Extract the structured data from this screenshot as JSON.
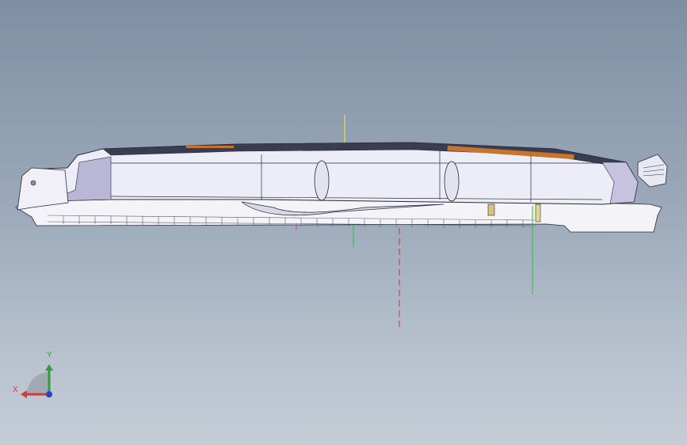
{
  "viewport": {
    "background_top": "#7f8fa3",
    "background_bottom": "#c4ccd6"
  },
  "model": {
    "body_fill": "#ecedf6",
    "body_shade": "#b9b6d6",
    "edge_color": "#2a2a3a",
    "accent_orange": "#c8742a",
    "axis_yellow": "#e6e635",
    "axis_green": "#35c24a",
    "axis_red": "#d23a3a"
  },
  "triad": {
    "x_label": "X",
    "y_label": "Y",
    "x_color": "#d23a3a",
    "y_color": "#2f9e3a",
    "z_color": "#2a3fd0"
  }
}
